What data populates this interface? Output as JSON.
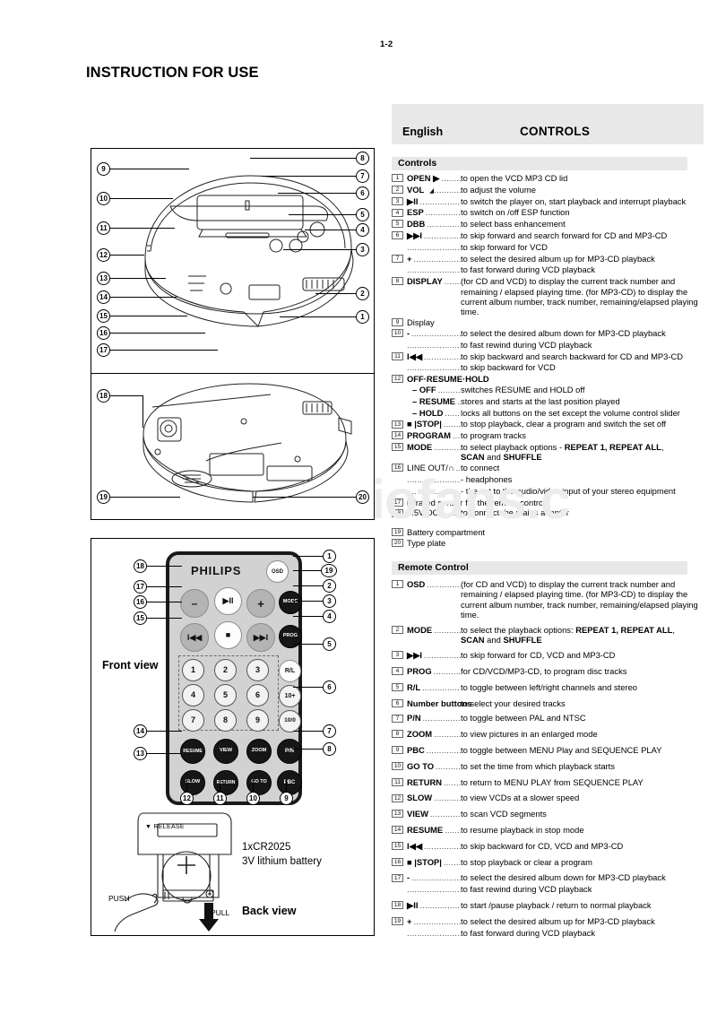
{
  "page": {
    "number": "1-2",
    "title": "INSTRUCTION FOR USE",
    "watermark": "www.radiofans.c"
  },
  "language_band": {
    "language": "English",
    "section": "CONTROLS"
  },
  "controls": {
    "heading": "Controls",
    "items": [
      {
        "n": "1",
        "term": "OPEN ▶",
        "desc": "to open the VCD MP3 CD lid"
      },
      {
        "n": "2",
        "term": "VOL",
        "glyph": "wedge",
        "desc": "to adjust the volume"
      },
      {
        "n": "3",
        "term": "▶II",
        "desc": "to switch the player on, start playback and interrupt playback"
      },
      {
        "n": "4",
        "term": "ESP",
        "desc": "to switch on /off ESP function"
      },
      {
        "n": "5",
        "term": "DBB",
        "desc": "to select bass enhancement"
      },
      {
        "n": "6",
        "term": "▶▶I",
        "desc": "to skip forward and search forward for CD and MP3-CD",
        "cont": "to skip forward for VCD"
      },
      {
        "n": "7",
        "term": "+",
        "desc": "to select the desired album up for MP3-CD playback",
        "cont": "to fast forward during VCD playback"
      },
      {
        "n": "8",
        "term": "DISPLAY",
        "desc": "(for CD and VCD) to display the current track number and remaining / elapsed playing time. (for MP3-CD) to display the current album number, track number, remaining/elapsed playing time."
      },
      {
        "n": "9",
        "term": "Display",
        "plain": true,
        "desc": ""
      },
      {
        "n": "10",
        "term": "-",
        "desc": "to select the desired album down for MP3-CD playback",
        "cont": "to fast rewind during VCD playback"
      },
      {
        "n": "11",
        "term": "I◀◀",
        "desc": "to skip backward and search backward for CD and MP3-CD",
        "cont": "to skip backward for VCD"
      },
      {
        "n": "12",
        "term": "OFF·RESUME·HOLD",
        "desc": "",
        "subitems": [
          {
            "label": "– OFF",
            "desc": "switches RESUME and HOLD off"
          },
          {
            "label": "– RESUME",
            "desc": "stores and starts at the last position played"
          },
          {
            "label": "– HOLD",
            "desc": "locks all buttons on the set except the volume control slider"
          }
        ]
      },
      {
        "n": "13",
        "term": "■ |STOP|",
        "desc": "to stop playback, clear a program and switch the set off"
      },
      {
        "n": "14",
        "term": "PROGRAM",
        "desc": "to program tracks"
      },
      {
        "n": "15",
        "term": "MODE",
        "desc_pre": "to select playback options - ",
        "bold1": "REPEAT 1, REPEAT ALL",
        "desc_mid": ",",
        "bold2": "SCAN",
        "desc_join": " and ",
        "bold3": "SHUFFLE"
      },
      {
        "n": "16",
        "term": "LINE OUT/∩",
        "plain": true,
        "desc": "to connect",
        "cont": "- headphones",
        "cont2": "- the set to the audio/video input of your stereo equipment"
      },
      {
        "n": "17",
        "term": "infrared sensor  for the remote control",
        "plain": true,
        "desc": ""
      },
      {
        "n": "18",
        "term": "4.5V DC",
        "plain": true,
        "desc": "to connect the mains adapter"
      },
      {
        "n": "19",
        "term": "Battery compartment",
        "plain": true,
        "desc": "",
        "spaced": true
      },
      {
        "n": "20",
        "term": "Type plate",
        "plain": true,
        "desc": ""
      }
    ]
  },
  "remote_control": {
    "heading": "Remote Control",
    "items": [
      {
        "n": "1",
        "term": "OSD",
        "desc": "(for CD and VCD) to display the current track number and remaining / elapsed playing time. (for MP3-CD) to display the current album number, track number, remaining/elapsed playing time."
      },
      {
        "n": "2",
        "term": "MODE",
        "desc_pre": "to select the playback options: ",
        "bold1": "REPEAT 1, REPEAT ALL",
        "desc_mid": ",",
        "bold2": "SCAN",
        "desc_join": " and ",
        "bold3": "SHUFFLE"
      },
      {
        "n": "3",
        "term": "▶▶I",
        "desc": "to skip forward for CD, VCD and MP3-CD"
      },
      {
        "n": "4",
        "term": "PROG",
        "desc": "for CD/VCD/MP3-CD, to program disc tracks"
      },
      {
        "n": "5",
        "term": "R/L",
        "desc": "to toggle between left/right channels and stereo"
      },
      {
        "n": "6",
        "term": "Number buttons",
        "desc": "to select your desired tracks",
        "nodots": true
      },
      {
        "n": "7",
        "term": "P/N",
        "desc": "to toggle between PAL and NTSC"
      },
      {
        "n": "8",
        "term": "ZOOM",
        "desc": "to view pictures in an enlarged mode"
      },
      {
        "n": "9",
        "term": "PBC",
        "desc": "to toggle between MENU Play and SEQUENCE PLAY"
      },
      {
        "n": "10",
        "term": "GO TO",
        "desc": "to set the time from which playback starts"
      },
      {
        "n": "11",
        "term": "RETURN",
        "desc": "to return to MENU PLAY from SEQUENCE PLAY"
      },
      {
        "n": "12",
        "term": "SLOW",
        "desc": "to view VCDs at a slower speed"
      },
      {
        "n": "13",
        "term": "VIEW",
        "desc": "to scan VCD segments"
      },
      {
        "n": "14",
        "term": "RESUME",
        "desc": "to resume playback in stop mode"
      },
      {
        "n": "15",
        "term": "I◀◀",
        "desc": "to skip backward for CD, VCD and MP3-CD"
      },
      {
        "n": "16",
        "term": "■ |STOP|",
        "desc": "to stop playback or clear a program"
      },
      {
        "n": "17",
        "term": "-",
        "desc": "to select the desired album down for MP3-CD playback",
        "cont": "to fast rewind during VCD playback"
      },
      {
        "n": "18",
        "term": "▶II",
        "desc": "to start /pause playback / return to normal playback"
      },
      {
        "n": "19",
        "term": "+",
        "desc": "to select the desired album up for MP3-CD playback",
        "cont": "to fast forward during VCD playback"
      }
    ]
  },
  "figures": {
    "player_top": {
      "callouts_left": [
        "9",
        "10",
        "11",
        "12",
        "13",
        "14",
        "15",
        "16",
        "17"
      ],
      "callouts_right": [
        "8",
        "7",
        "6",
        "5",
        "4",
        "3",
        "2",
        "1"
      ]
    },
    "player_bottom": {
      "callouts": [
        "18",
        "19",
        "20"
      ]
    },
    "remote": {
      "brand": "PHILIPS",
      "front_view_label": "Front view",
      "back_view_label": "Back view",
      "callouts_left": [
        "18",
        "17",
        "16",
        "15",
        "14",
        "13"
      ],
      "callouts_right": [
        "1",
        "19",
        "2",
        "3",
        "4",
        "5",
        "6",
        "7",
        "8"
      ],
      "callouts_bottom": [
        "12",
        "11",
        "10",
        "9"
      ],
      "buttons": {
        "osd": "OSD",
        "mode": "MODE",
        "prog": "PROG",
        "rl": "R/L",
        "minus": "–",
        "plus": "+",
        "play_pause": "▶II",
        "stop": "■",
        "prev": "I◀◀",
        "next": "▶▶I",
        "numbers": [
          "1",
          "2",
          "3",
          "4",
          "5",
          "6",
          "7",
          "8",
          "9"
        ],
        "ten_plus": "10+",
        "ten_zero": "10/0",
        "resume": "RESUME",
        "view": "VIEW",
        "zoom": "ZOOM",
        "pn": "P/N",
        "slow": "SLOW",
        "return": "RETURN",
        "goto": "GO TO",
        "pbc": "PBC"
      }
    },
    "battery": {
      "release_label": "▼ RELEASE",
      "push_label": "PUSH",
      "pull_label": "PULL",
      "spec_line1": "1xCR2025",
      "spec_line2": "3V lithium battery"
    }
  }
}
